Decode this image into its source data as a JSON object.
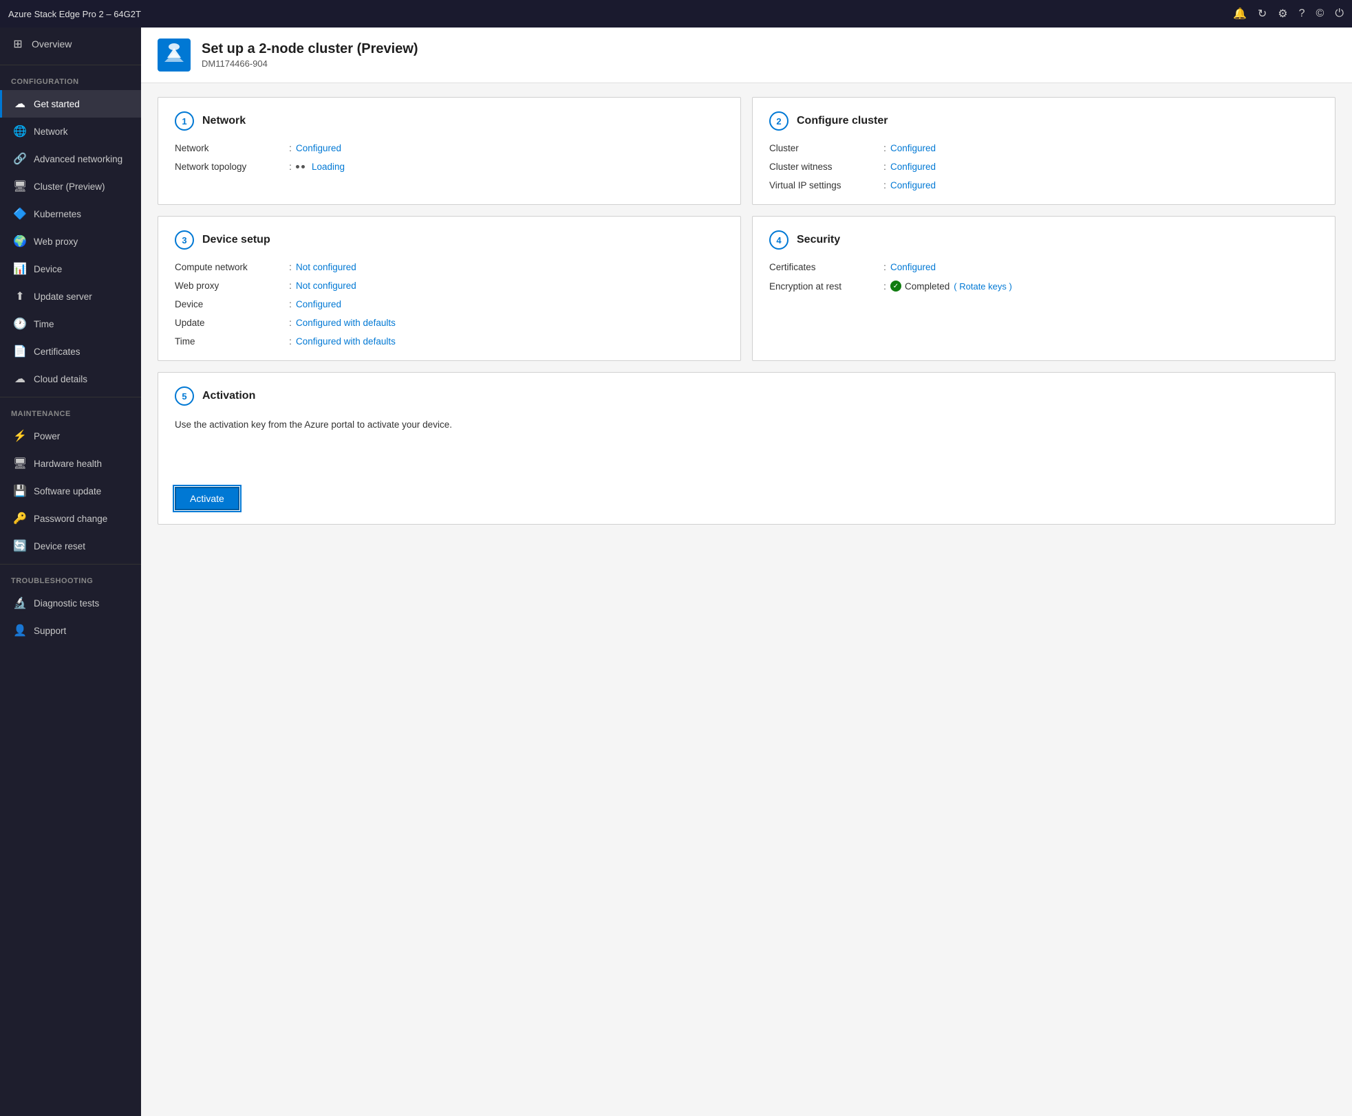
{
  "titlebar": {
    "title": "Azure Stack Edge Pro 2 – 64G2T",
    "icons": [
      "bell",
      "refresh",
      "settings",
      "help",
      "user",
      "power"
    ]
  },
  "sidebar": {
    "overview_label": "Overview",
    "sections": [
      {
        "label": "CONFIGURATION",
        "items": [
          {
            "id": "get-started",
            "label": "Get started",
            "icon": "☁",
            "active": true
          },
          {
            "id": "network",
            "label": "Network",
            "icon": "🌐"
          },
          {
            "id": "advanced-networking",
            "label": "Advanced networking",
            "icon": "🔗"
          },
          {
            "id": "cluster",
            "label": "Cluster (Preview)",
            "icon": "🖥"
          },
          {
            "id": "kubernetes",
            "label": "Kubernetes",
            "icon": "🔷"
          },
          {
            "id": "web-proxy",
            "label": "Web proxy",
            "icon": "🌍"
          },
          {
            "id": "device",
            "label": "Device",
            "icon": "📊"
          },
          {
            "id": "update-server",
            "label": "Update server",
            "icon": "⬆"
          },
          {
            "id": "time",
            "label": "Time",
            "icon": "🕐"
          },
          {
            "id": "certificates",
            "label": "Certificates",
            "icon": "📄"
          },
          {
            "id": "cloud-details",
            "label": "Cloud details",
            "icon": "☁"
          }
        ]
      },
      {
        "label": "MAINTENANCE",
        "items": [
          {
            "id": "power",
            "label": "Power",
            "icon": "⚡"
          },
          {
            "id": "hardware-health",
            "label": "Hardware health",
            "icon": "🖥"
          },
          {
            "id": "software-update",
            "label": "Software update",
            "icon": "💾"
          },
          {
            "id": "password-change",
            "label": "Password change",
            "icon": "🔑"
          },
          {
            "id": "device-reset",
            "label": "Device reset",
            "icon": "🔄"
          }
        ]
      },
      {
        "label": "TROUBLESHOOTING",
        "items": [
          {
            "id": "diagnostic-tests",
            "label": "Diagnostic tests",
            "icon": "🔬"
          },
          {
            "id": "support",
            "label": "Support",
            "icon": "👤"
          }
        ]
      }
    ]
  },
  "page": {
    "title": "Set up a 2-node cluster (Preview)",
    "subtitle": "DM1174466-904",
    "cards": [
      {
        "step": "1",
        "title": "Network",
        "rows": [
          {
            "label": "Network",
            "value": "Configured",
            "value_type": "link"
          },
          {
            "label": "Network topology",
            "value": "Loading",
            "value_type": "loading-link"
          }
        ]
      },
      {
        "step": "2",
        "title": "Configure cluster",
        "rows": [
          {
            "label": "Cluster",
            "value": "Configured",
            "value_type": "link"
          },
          {
            "label": "Cluster witness",
            "value": "Configured",
            "value_type": "link"
          },
          {
            "label": "Virtual IP settings",
            "value": "Configured",
            "value_type": "link"
          }
        ]
      },
      {
        "step": "3",
        "title": "Device setup",
        "rows": [
          {
            "label": "Compute network",
            "value": "Not configured",
            "value_type": "link"
          },
          {
            "label": "Web proxy",
            "value": "Not configured",
            "value_type": "link"
          },
          {
            "label": "Device",
            "value": "Configured",
            "value_type": "link"
          },
          {
            "label": "Update",
            "value": "Configured with defaults",
            "value_type": "link"
          },
          {
            "label": "Time",
            "value": "Configured with defaults",
            "value_type": "link"
          }
        ]
      },
      {
        "step": "4",
        "title": "Security",
        "rows": [
          {
            "label": "Certificates",
            "value": "Configured",
            "value_type": "link"
          },
          {
            "label": "Encryption at rest",
            "value": "Completed",
            "value_type": "completed",
            "extra": "( Rotate keys )"
          }
        ]
      }
    ],
    "activation": {
      "step": "5",
      "title": "Activation",
      "description": "Use the activation key from the Azure portal to activate your device.",
      "button_label": "Activate"
    }
  }
}
